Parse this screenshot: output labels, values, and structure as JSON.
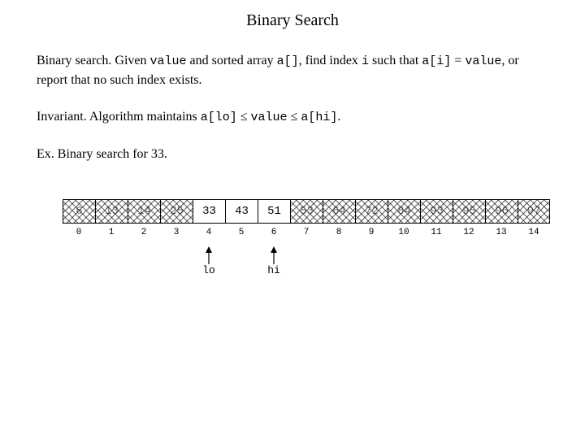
{
  "title": "Binary Search",
  "p1": {
    "lead": "Binary search.",
    "t1": "  Given ",
    "c1": "value",
    "t2": " and sorted array ",
    "c2": "a[]",
    "t3": ", find index ",
    "c3": "i",
    "t4": " such that ",
    "c4": "a[i]",
    "t5": " = ",
    "c5": "value",
    "t6": ", or report that no such index exists."
  },
  "p2": {
    "lead": "Invariant.",
    "t1": "  Algorithm maintains ",
    "c1": "a[lo]",
    "le1": " ≤ ",
    "c2": "value",
    "le2": " ≤ ",
    "c3": "a[hi]",
    "t2": "."
  },
  "p3": {
    "lead": "Ex.",
    "t1": "  Binary search for 33."
  },
  "array": {
    "values": [
      "6",
      "13",
      "14",
      "25",
      "33",
      "43",
      "51",
      "53",
      "64",
      "72",
      "84",
      "93",
      "95",
      "96",
      "97"
    ],
    "indices": [
      "0",
      "1",
      "2",
      "3",
      "4",
      "5",
      "6",
      "7",
      "8",
      "9",
      "10",
      "11",
      "12",
      "13",
      "14"
    ],
    "active": [
      false,
      false,
      false,
      false,
      true,
      true,
      true,
      false,
      false,
      false,
      false,
      false,
      false,
      false,
      false
    ]
  },
  "pointers": {
    "lo": {
      "label": "lo",
      "index": 4
    },
    "hi": {
      "label": "hi",
      "index": 6
    }
  }
}
